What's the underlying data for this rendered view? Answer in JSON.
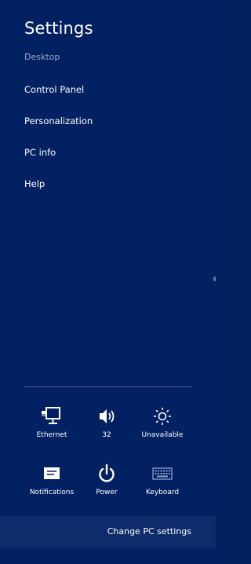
{
  "panel": {
    "title": "Settings",
    "context": "Desktop"
  },
  "menu": {
    "items": [
      {
        "label": "Control Panel"
      },
      {
        "label": "Personalization"
      },
      {
        "label": "PC info"
      },
      {
        "label": "Help"
      }
    ]
  },
  "quick_settings": {
    "row1": [
      {
        "label": "Ethernet",
        "icon": "ethernet-icon"
      },
      {
        "label": "32",
        "icon": "volume-icon"
      },
      {
        "label": "Unavailable",
        "icon": "brightness-icon"
      }
    ],
    "row2": [
      {
        "label": "Notifications",
        "icon": "notifications-icon"
      },
      {
        "label": "Power",
        "icon": "power-icon"
      },
      {
        "label": "Keyboard",
        "icon": "keyboard-icon"
      }
    ]
  },
  "footer": {
    "change_label": "Change PC settings"
  },
  "colors": {
    "background": "#022163",
    "footer_bar": "#0e2c6b",
    "muted_text": "#9ea9c4"
  }
}
